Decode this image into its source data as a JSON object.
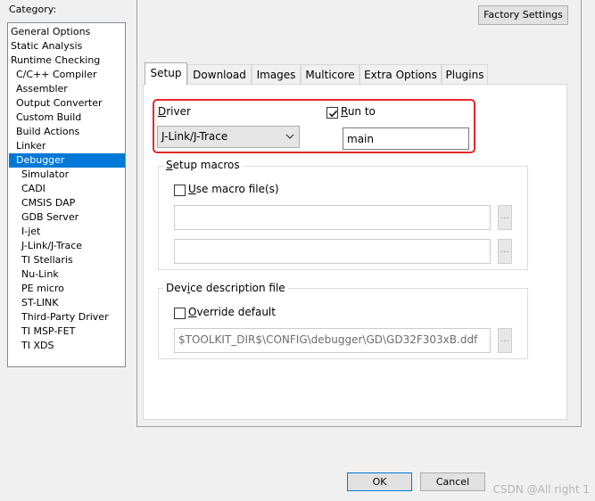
{
  "category": {
    "label": "Category:",
    "items": [
      {
        "label": "General Options",
        "indent": 0,
        "selected": false
      },
      {
        "label": "Static Analysis",
        "indent": 0,
        "selected": false
      },
      {
        "label": "Runtime Checking",
        "indent": 0,
        "selected": false
      },
      {
        "label": "C/C++ Compiler",
        "indent": 1,
        "selected": false
      },
      {
        "label": "Assembler",
        "indent": 1,
        "selected": false
      },
      {
        "label": "Output Converter",
        "indent": 1,
        "selected": false
      },
      {
        "label": "Custom Build",
        "indent": 1,
        "selected": false
      },
      {
        "label": "Build Actions",
        "indent": 1,
        "selected": false
      },
      {
        "label": "Linker",
        "indent": 1,
        "selected": false
      },
      {
        "label": "Debugger",
        "indent": 1,
        "selected": true
      },
      {
        "label": "Simulator",
        "indent": 2,
        "selected": false
      },
      {
        "label": "CADI",
        "indent": 2,
        "selected": false
      },
      {
        "label": "CMSIS DAP",
        "indent": 2,
        "selected": false
      },
      {
        "label": "GDB Server",
        "indent": 2,
        "selected": false
      },
      {
        "label": "I-jet",
        "indent": 2,
        "selected": false
      },
      {
        "label": "J-Link/J-Trace",
        "indent": 2,
        "selected": false
      },
      {
        "label": "TI Stellaris",
        "indent": 2,
        "selected": false
      },
      {
        "label": "Nu-Link",
        "indent": 2,
        "selected": false
      },
      {
        "label": "PE micro",
        "indent": 2,
        "selected": false
      },
      {
        "label": "ST-LINK",
        "indent": 2,
        "selected": false
      },
      {
        "label": "Third-Party Driver",
        "indent": 2,
        "selected": false
      },
      {
        "label": "TI MSP-FET",
        "indent": 2,
        "selected": false
      },
      {
        "label": "TI XDS",
        "indent": 2,
        "selected": false
      }
    ]
  },
  "factory_settings_label": "Factory Settings",
  "tabs": [
    {
      "label": "Setup",
      "active": true
    },
    {
      "label": "Download",
      "active": false
    },
    {
      "label": "Images",
      "active": false
    },
    {
      "label": "Multicore",
      "active": false
    },
    {
      "label": "Extra Options",
      "active": false
    },
    {
      "label": "Plugins",
      "active": false
    }
  ],
  "setup": {
    "driver_label_first": "D",
    "driver_label_rest": "river",
    "driver_value": "J-Link/J-Trace",
    "run_to_label_first": "R",
    "run_to_label_rest": "un to",
    "run_to_checked": true,
    "run_to_value": "main",
    "setup_macros_title_first": "S",
    "setup_macros_title_rest": "etup macros",
    "use_macro_label_first": "U",
    "use_macro_label_rest": "se macro file(s)",
    "use_macro_checked": false,
    "macro_file_1": "",
    "macro_file_2": "",
    "browse_label": "...",
    "device_desc_title_pre": "Dev",
    "device_desc_title_ul": "i",
    "device_desc_title_post": "ce description file",
    "override_label_first": "O",
    "override_label_rest": "verride default",
    "override_checked": false,
    "device_desc_path": "$TOOLKIT_DIR$\\CONFIG\\debugger\\GD\\GD32F303xB.ddf"
  },
  "buttons": {
    "ok": "OK",
    "cancel": "Cancel"
  },
  "watermark": "CSDN @All right 1"
}
